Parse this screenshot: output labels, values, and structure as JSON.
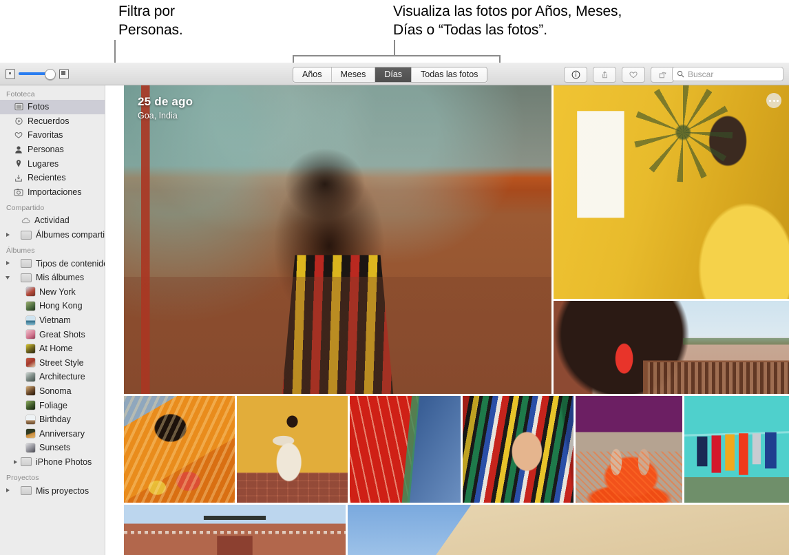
{
  "callouts": {
    "left": "Filtra por\nPersonas.",
    "right": "Visualiza las fotos por Años, Meses,\nDías o “Todas las fotos”."
  },
  "toolbar": {
    "zoom": {
      "small_icon": "small-grid-icon",
      "large_icon": "large-grid-icon",
      "value": 66
    },
    "segments": [
      {
        "label": "Años",
        "active": false
      },
      {
        "label": "Meses",
        "active": false
      },
      {
        "label": "Días",
        "active": true
      },
      {
        "label": "Todas las fotos",
        "active": false
      }
    ],
    "buttons": [
      {
        "name": "info-icon",
        "label": "Información"
      },
      {
        "name": "share-icon",
        "label": "Compartir"
      },
      {
        "name": "heart-icon",
        "label": "Favorita"
      },
      {
        "name": "rotate-icon",
        "label": "Girar"
      }
    ],
    "search": {
      "placeholder": "Buscar",
      "value": "",
      "icon": "search-icon"
    }
  },
  "sidebar": {
    "sections": [
      {
        "title": "Fototeca",
        "items": [
          {
            "label": "Fotos",
            "icon": "photos-icon",
            "selected": true
          },
          {
            "label": "Recuerdos",
            "icon": "memories-icon",
            "selected": false
          },
          {
            "label": "Favoritas",
            "icon": "heart-icon",
            "selected": false
          },
          {
            "label": "Personas",
            "icon": "person-icon",
            "selected": false
          },
          {
            "label": "Lugares",
            "icon": "pin-icon",
            "selected": false
          },
          {
            "label": "Recientes",
            "icon": "download-icon",
            "selected": false
          },
          {
            "label": "Importaciones",
            "icon": "import-icon",
            "selected": false
          }
        ]
      },
      {
        "title": "Compartido",
        "items": [
          {
            "label": "Actividad",
            "icon": "cloud-icon",
            "selected": false
          },
          {
            "label": "Álbumes compartidos",
            "icon": "folder-icon",
            "disclosure": "closed",
            "selected": false
          }
        ]
      },
      {
        "title": "Álbumes",
        "items": [
          {
            "label": "Tipos de contenido",
            "icon": "folder-icon",
            "disclosure": "closed",
            "selected": false
          },
          {
            "label": "Mis álbumes",
            "icon": "folder-icon",
            "disclosure": "open",
            "selected": false
          },
          {
            "label": "New York",
            "icon": "album-thumb",
            "color": "#b4493a",
            "indent": 2,
            "selected": false
          },
          {
            "label": "Hong Kong",
            "icon": "album-thumb",
            "color": "#4c6b3f",
            "indent": 2,
            "selected": false
          },
          {
            "label": "Vietnam",
            "icon": "album-thumb",
            "color": "#7fb7cc",
            "indent": 2,
            "selected": false
          },
          {
            "label": "Great Shots",
            "icon": "album-thumb",
            "color": "#d1758f",
            "indent": 2,
            "selected": false
          },
          {
            "label": "At Home",
            "icon": "album-thumb",
            "color": "#c9b52e",
            "indent": 2,
            "selected": false
          },
          {
            "label": "Street Style",
            "icon": "album-thumb",
            "color": "#a33a2e",
            "indent": 2,
            "selected": false
          },
          {
            "label": "Architecture",
            "icon": "album-thumb",
            "color": "#7d8b86",
            "indent": 2,
            "selected": false
          },
          {
            "label": "Sonoma",
            "icon": "album-thumb",
            "color": "#6b4a2c",
            "indent": 2,
            "selected": false
          },
          {
            "label": "Foliage",
            "icon": "album-thumb",
            "color": "#3f5a2b",
            "indent": 2,
            "selected": false
          },
          {
            "label": "Birthday",
            "icon": "album-thumb",
            "color": "#cfd6d8",
            "indent": 2,
            "selected": false
          },
          {
            "label": "Anniversary",
            "icon": "album-thumb",
            "color": "#3c4a2a",
            "indent": 2,
            "selected": false
          },
          {
            "label": "Sunsets",
            "icon": "album-thumb",
            "color": "#9a9aa0",
            "indent": 2,
            "selected": false
          },
          {
            "label": "iPhone Photos",
            "icon": "folder-icon",
            "disclosure": "closed",
            "indent": 1,
            "selected": false
          }
        ]
      },
      {
        "title": "Proyectos",
        "items": [
          {
            "label": "Mis proyectos",
            "icon": "folder-icon",
            "disclosure": "closed",
            "selected": false
          }
        ]
      }
    ]
  },
  "main": {
    "day_header": {
      "date": "25 de ago",
      "place": "Goa, India"
    },
    "more_options": "more-options-button",
    "photos": [
      {
        "name": "woman-striped-dress-wall",
        "caption": "Mujer con vestido de rayas ante muro descascarado"
      },
      {
        "name": "man-yellow-kurta",
        "caption": "Hombre con kurta amarilla junto a pared amarilla"
      },
      {
        "name": "woman-red-sari-monument",
        "caption": "Mujer con sari rojo caminando en monumento"
      },
      {
        "name": "woman-orange-headscarf",
        "caption": "Mujer con pañuelo naranja"
      },
      {
        "name": "woman-white-sari-dancing",
        "caption": "Mujer con sari blanco sobre pared amarilla"
      },
      {
        "name": "woman-red-veil-blue-wall",
        "caption": "Mujer con velo rojo ante pared azul"
      },
      {
        "name": "hand-striped-fabric",
        "caption": "Mano sobre tela de rayas de colores"
      },
      {
        "name": "feet-orange-powder",
        "caption": "Pies descalzos sobre polvo naranja"
      },
      {
        "name": "clothesline-turquoise-wall",
        "caption": "Ropa tendida ante pared turquesa"
      },
      {
        "name": "mughal-gateway",
        "caption": "Portal mogol de arenisca roja"
      },
      {
        "name": "sky-and-dune",
        "caption": "Cielo azul y duna de arena"
      }
    ]
  }
}
